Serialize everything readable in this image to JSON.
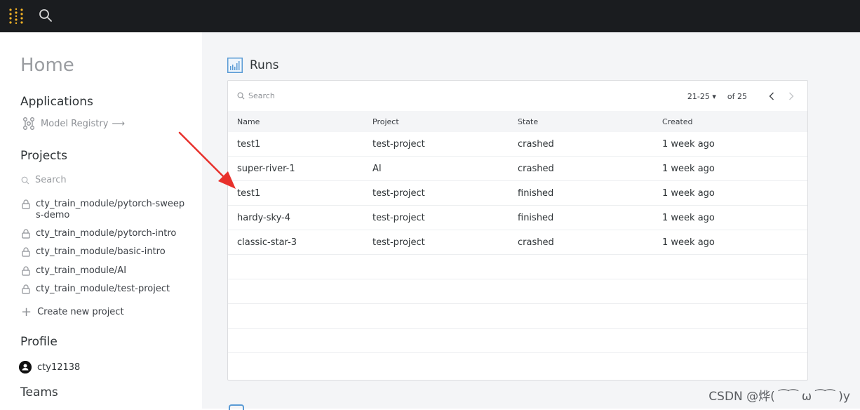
{
  "topbar": {
    "logo_icon": "wandb-dots-icon",
    "search_icon": "search-icon"
  },
  "sidebar": {
    "home_title": "Home",
    "applications": {
      "title": "Applications",
      "model_registry": "Model Registry"
    },
    "projects": {
      "title": "Projects",
      "search_placeholder": "Search",
      "items": [
        {
          "label": "cty_train_module/pytorch-sweeps-demo"
        },
        {
          "label": "cty_train_module/pytorch-intro"
        },
        {
          "label": "cty_train_module/basic-intro"
        },
        {
          "label": "cty_train_module/AI"
        },
        {
          "label": "cty_train_module/test-project"
        }
      ],
      "create_label": "Create new project"
    },
    "profile": {
      "title": "Profile",
      "username": "cty12138"
    },
    "teams": {
      "title": "Teams"
    }
  },
  "runs": {
    "title": "Runs",
    "search_placeholder": "Search",
    "pager": {
      "range": "21-25",
      "of": "of 25"
    },
    "columns": {
      "name": "Name",
      "project": "Project",
      "state": "State",
      "created": "Created"
    },
    "rows": [
      {
        "name": "test1",
        "project": "test-project",
        "state": "crashed",
        "created": "1 week ago"
      },
      {
        "name": "super-river-1",
        "project": "AI",
        "state": "crashed",
        "created": "1 week ago"
      },
      {
        "name": "test1",
        "project": "test-project",
        "state": "finished",
        "created": "1 week ago"
      },
      {
        "name": "hardy-sky-4",
        "project": "test-project",
        "state": "finished",
        "created": "1 week ago"
      },
      {
        "name": "classic-star-3",
        "project": "test-project",
        "state": "crashed",
        "created": "1 week ago"
      }
    ]
  },
  "colors": {
    "topbar": "#1a1c1f",
    "logo_gold": "#f5b325",
    "annotation_arrow": "#e8302b",
    "main_bg": "#f4f5f7"
  },
  "watermark": "CSDN @烨( ⁀⁀ ω ⁀⁀ )y"
}
